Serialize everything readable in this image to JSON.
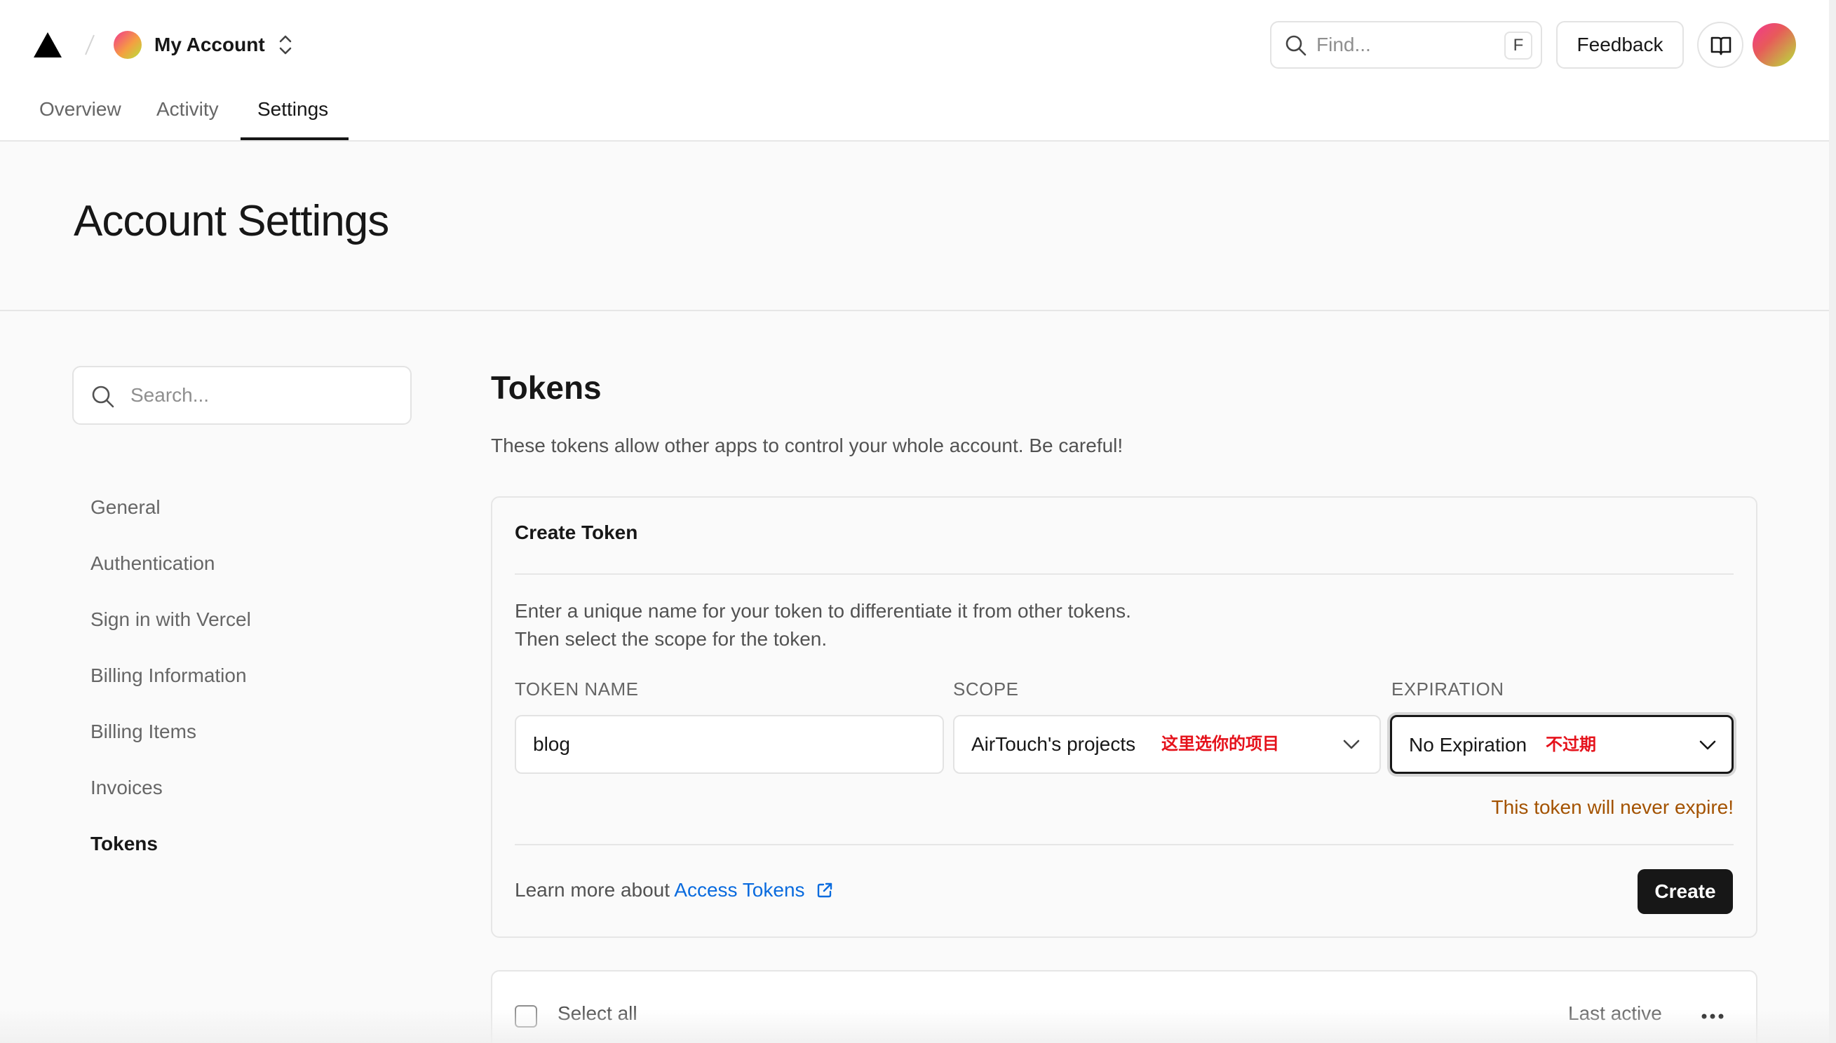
{
  "header": {
    "account_name": "My Account",
    "find_placeholder": "Find...",
    "find_shortcut": "F",
    "feedback_label": "Feedback",
    "tabs": [
      {
        "label": "Overview",
        "active": false
      },
      {
        "label": "Activity",
        "active": false
      },
      {
        "label": "Settings",
        "active": true
      }
    ]
  },
  "page": {
    "title": "Account Settings"
  },
  "sidebar": {
    "search_placeholder": "Search...",
    "items": [
      {
        "label": "General",
        "active": false
      },
      {
        "label": "Authentication",
        "active": false
      },
      {
        "label": "Sign in with Vercel",
        "active": false
      },
      {
        "label": "Billing Information",
        "active": false
      },
      {
        "label": "Billing Items",
        "active": false
      },
      {
        "label": "Invoices",
        "active": false
      },
      {
        "label": "Tokens",
        "active": true
      }
    ]
  },
  "tokens": {
    "title": "Tokens",
    "description": "These tokens allow other apps to control your whole account. Be careful!",
    "create_card": {
      "title": "Create Token",
      "help_line1": "Enter a unique name for your token to differentiate it from other tokens.",
      "help_line2": "Then select the scope for the token.",
      "token_name_label": "TOKEN NAME",
      "token_name_value": "blog",
      "scope_label": "SCOPE",
      "scope_value": "AirTouch's projects",
      "scope_note": "这里选你的项目",
      "expiration_label": "EXPIRATION",
      "expiration_value": "No Expiration",
      "expiration_note": "不过期",
      "warning": "This token will never expire!",
      "learn_prefix": "Learn more about",
      "learn_link": "Access Tokens",
      "create_label": "Create"
    },
    "list": {
      "select_all": "Select all",
      "sort_label": "Last active"
    }
  },
  "colors": {
    "accent_link": "#0a6bde",
    "warning": "#a35200",
    "annotation": "#e5121b",
    "primary_button": "#171717"
  }
}
